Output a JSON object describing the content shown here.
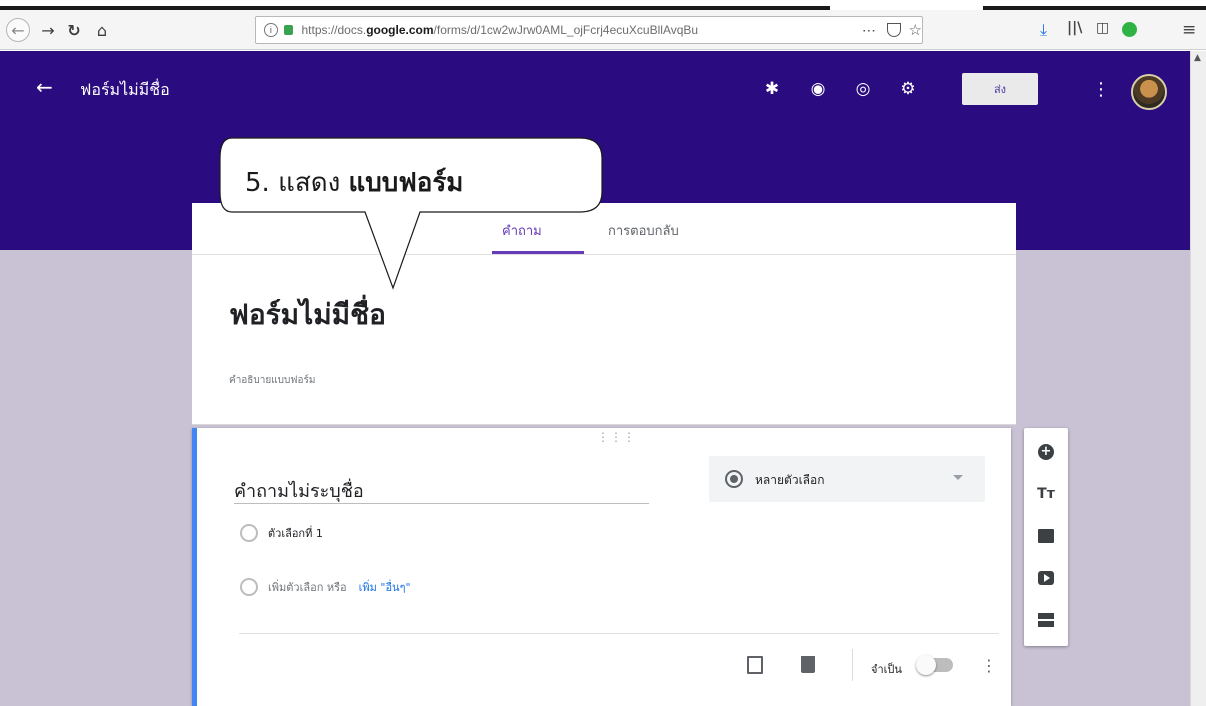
{
  "browser": {
    "url_prefix": "https://docs.",
    "url_domain": "google.com",
    "url_rest": "/forms/d/1cw2wJrw0AML_ojFcrj4ecuXcuBllAvqBu",
    "more_actions": "⋯"
  },
  "header": {
    "form_title": "ฟอร์มไม่มีชื่อ",
    "send_label": "ส่ง",
    "icons": [
      "addons-icon",
      "palette-icon",
      "preview-eye-icon",
      "settings-gear-icon"
    ],
    "accent_color": "#2a0b80"
  },
  "tabs": [
    {
      "label": "คำถาม",
      "active": true
    },
    {
      "label": "การตอบกลับ",
      "active": false
    }
  ],
  "form": {
    "title": "ฟอร์มไม่มีชื่อ",
    "description_placeholder": "คำอธิบายแบบฟอร์ม"
  },
  "question": {
    "title": "คำถามไม่ระบุชื่อ",
    "type": "หลายตัวเลือก",
    "option1": "ตัวเลือกที่ 1",
    "add_option": "เพิ่มตัวเลือก หรือ",
    "add_other": "เพิ่ม \"อื่นๆ\"",
    "required_label": "จำเป็น",
    "required_on": false
  },
  "side_toolbar": {
    "icons": [
      "add-question-icon",
      "add-title-icon",
      "add-image-icon",
      "add-video-icon",
      "add-section-icon"
    ],
    "title_glyph": "Tт"
  },
  "callout": {
    "prefix": "5. แสดง ",
    "bold": "แบบฟอร์ม"
  }
}
